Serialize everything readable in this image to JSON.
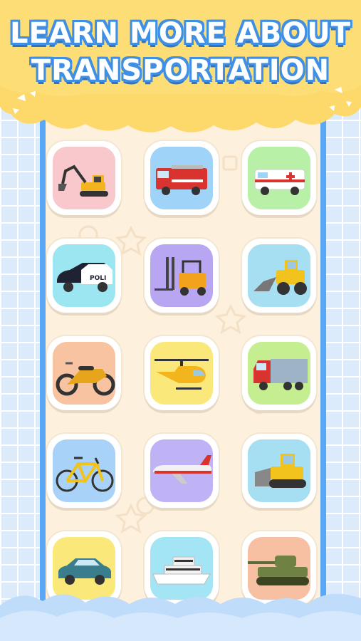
{
  "header": {
    "title_line1": "LEARN MORE ABOUT",
    "title_line2": "TRANSPORTATION"
  },
  "colors": {
    "banner": "#fdd86a",
    "title_outline": "#3f8fe4",
    "panel": "#fdf0dd",
    "panel_border": "#5aa8f5",
    "background": "#dcebfb"
  },
  "vehicles": [
    {
      "icon": "excavator-icon",
      "bg": "#f8c8cc"
    },
    {
      "icon": "fire-truck-icon",
      "bg": "#9fd3f7"
    },
    {
      "icon": "ambulance-icon",
      "bg": "#b8f0a8"
    },
    {
      "icon": "police-car-icon",
      "bg": "#9ce6f2"
    },
    {
      "icon": "forklift-icon",
      "bg": "#b8a6f2"
    },
    {
      "icon": "bulldozer-loader-icon",
      "bg": "#a6dff2"
    },
    {
      "icon": "motorcycle-icon",
      "bg": "#f7c3a0"
    },
    {
      "icon": "helicopter-icon",
      "bg": "#fae97a"
    },
    {
      "icon": "cargo-truck-icon",
      "bg": "#c4ee8f"
    },
    {
      "icon": "bicycle-icon",
      "bg": "#a8d2f7"
    },
    {
      "icon": "airplane-icon",
      "bg": "#bfb2f5"
    },
    {
      "icon": "bulldozer-icon",
      "bg": "#a6dff2"
    },
    {
      "icon": "car-icon",
      "bg": "#fae97a"
    },
    {
      "icon": "ship-icon",
      "bg": "#a3e4f5"
    },
    {
      "icon": "tank-icon",
      "bg": "#f7c0a3"
    }
  ]
}
